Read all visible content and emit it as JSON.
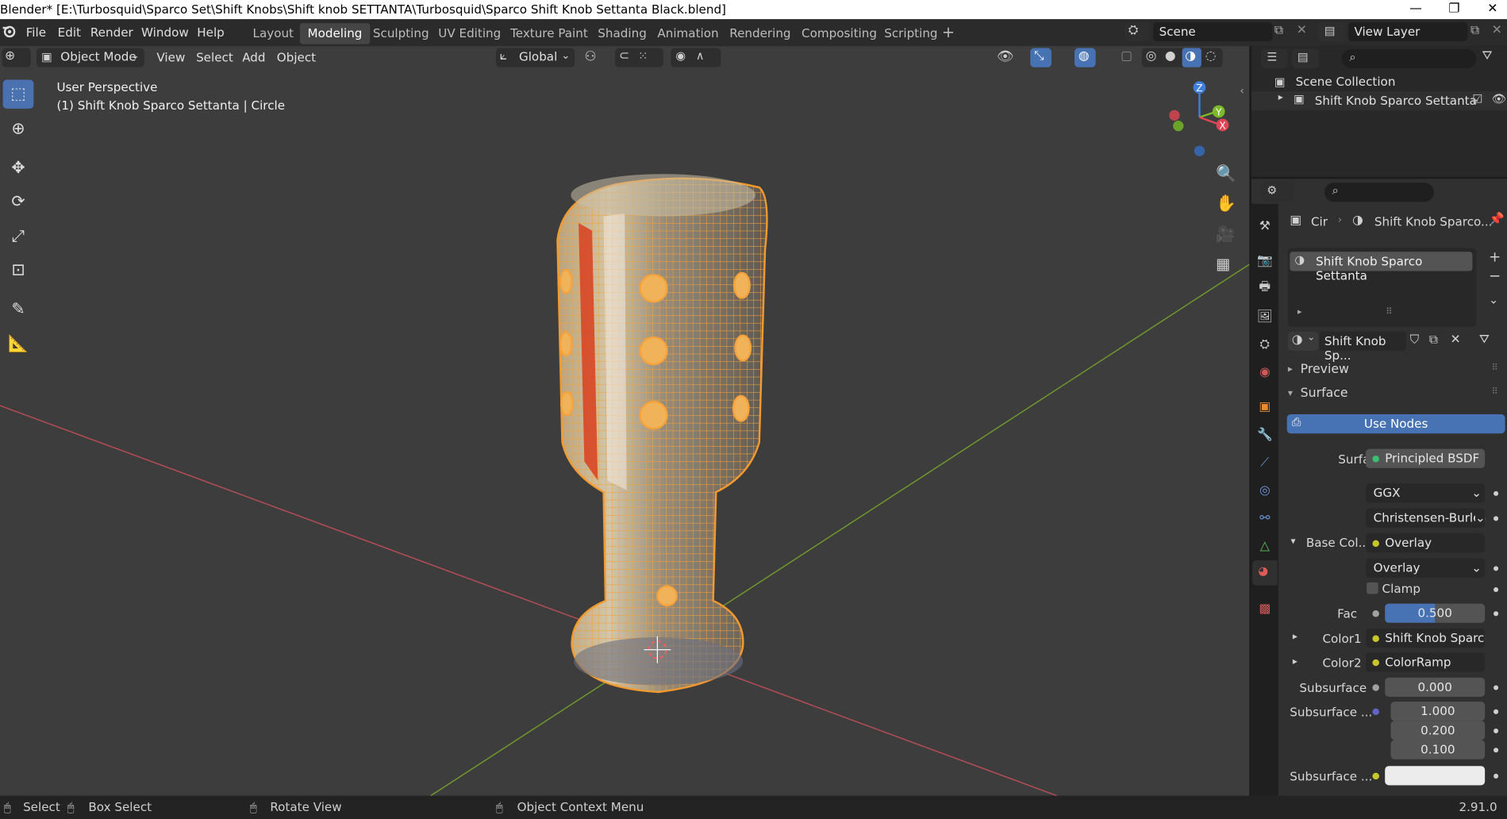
{
  "window": {
    "title": "Blender* [E:\\Turbosquid\\Sparco Set\\Shift Knobs\\Shift knob SETTANTA\\Turbosquid\\Sparco Shift Knob Settanta Black.blend]",
    "controls": {
      "minimize": "—",
      "restore": "❐",
      "close": "✕"
    }
  },
  "menu": {
    "file": "File",
    "edit": "Edit",
    "render": "Render",
    "window": "Window",
    "help": "Help"
  },
  "workspaces": [
    "Layout",
    "Modeling",
    "Sculpting",
    "UV Editing",
    "Texture Paint",
    "Shading",
    "Animation",
    "Rendering",
    "Compositing",
    "Scripting"
  ],
  "workspace_active": "Modeling",
  "scene": {
    "name": "Scene",
    "view_layer": "View Layer"
  },
  "viewport_header": {
    "mode": "Object Mode",
    "view": "View",
    "select": "Select",
    "add": "Add",
    "object": "Object",
    "orientation": "Global"
  },
  "viewport": {
    "perspective": "User Perspective",
    "object_info": "(1) Shift Knob Sparco Settanta | Circle",
    "gizmo": {
      "x": "X",
      "y": "Y",
      "z": "Z"
    }
  },
  "outliner": {
    "root": "Scene Collection",
    "items": [
      {
        "label": "Shift Knob Sparco Settanta"
      }
    ]
  },
  "properties": {
    "breadcrumb_object": "Cir",
    "breadcrumb_material": "Shift Knob Sparco...",
    "material_slot": "Shift Knob Sparco Settanta",
    "material_name": "Shift Knob Sp...",
    "panels": {
      "preview": "Preview",
      "surface": "Surface"
    },
    "use_nodes": "Use Nodes",
    "surface_label": "Surface",
    "surface_value": "Principled BSDF",
    "distribution": "GGX",
    "subsurface_method": "Christensen-Burley",
    "base_color_label": "Base Col...",
    "base_color_value": "Overlay",
    "blend_mode": "Overlay",
    "clamp_label": "Clamp",
    "fac_label": "Fac",
    "fac_value": "0.500",
    "fac_fraction": 0.5,
    "color1_label": "Color1",
    "color1_value": "Shift Knob Sparco ...",
    "color2_label": "Color2",
    "color2_value": "ColorRamp",
    "subsurface_label": "Subsurface",
    "subsurface_value": "0.000",
    "subsurface_radius_label": "Subsurface ...",
    "subsurface_radius": [
      "1.000",
      "0.200",
      "0.100"
    ],
    "subsurface_color_label": "Subsurface ..."
  },
  "statusbar": {
    "select": "Select",
    "box_select": "Box Select",
    "rotate_view": "Rotate View",
    "context_menu": "Object Context Menu",
    "version": "2.91.0"
  },
  "colors": {
    "accent": "#4772b3",
    "selection_orange": "#f29a2e",
    "axis_x": "#e04556",
    "axis_y": "#7dba2a",
    "axis_z": "#3f7fdb"
  }
}
